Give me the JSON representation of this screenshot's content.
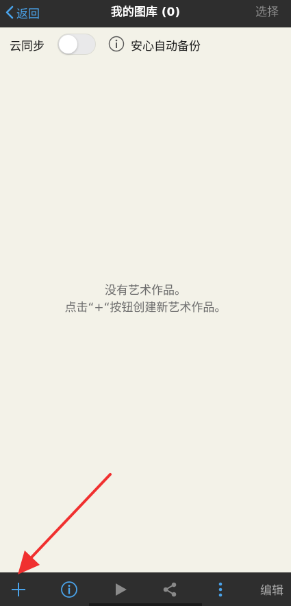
{
  "header": {
    "back_label": "返回",
    "title": "我的图库 (0)",
    "select_label": "选择"
  },
  "sync": {
    "label": "云同步",
    "enabled": false,
    "backup_label": "安心自动备份"
  },
  "empty_state": {
    "line1": "没有艺术作品。",
    "line2": "点击“+“按钮创建新艺术作品。"
  },
  "toolbar": {
    "icons": [
      "add-icon",
      "info-icon",
      "play-icon",
      "share-icon",
      "more-icon"
    ],
    "edit_label": "编辑"
  },
  "colors": {
    "accent": "#4aa3ea",
    "bar_background": "#2e2e2e",
    "page_background": "#f3f2e8",
    "annotation_arrow": "#f0302f"
  }
}
